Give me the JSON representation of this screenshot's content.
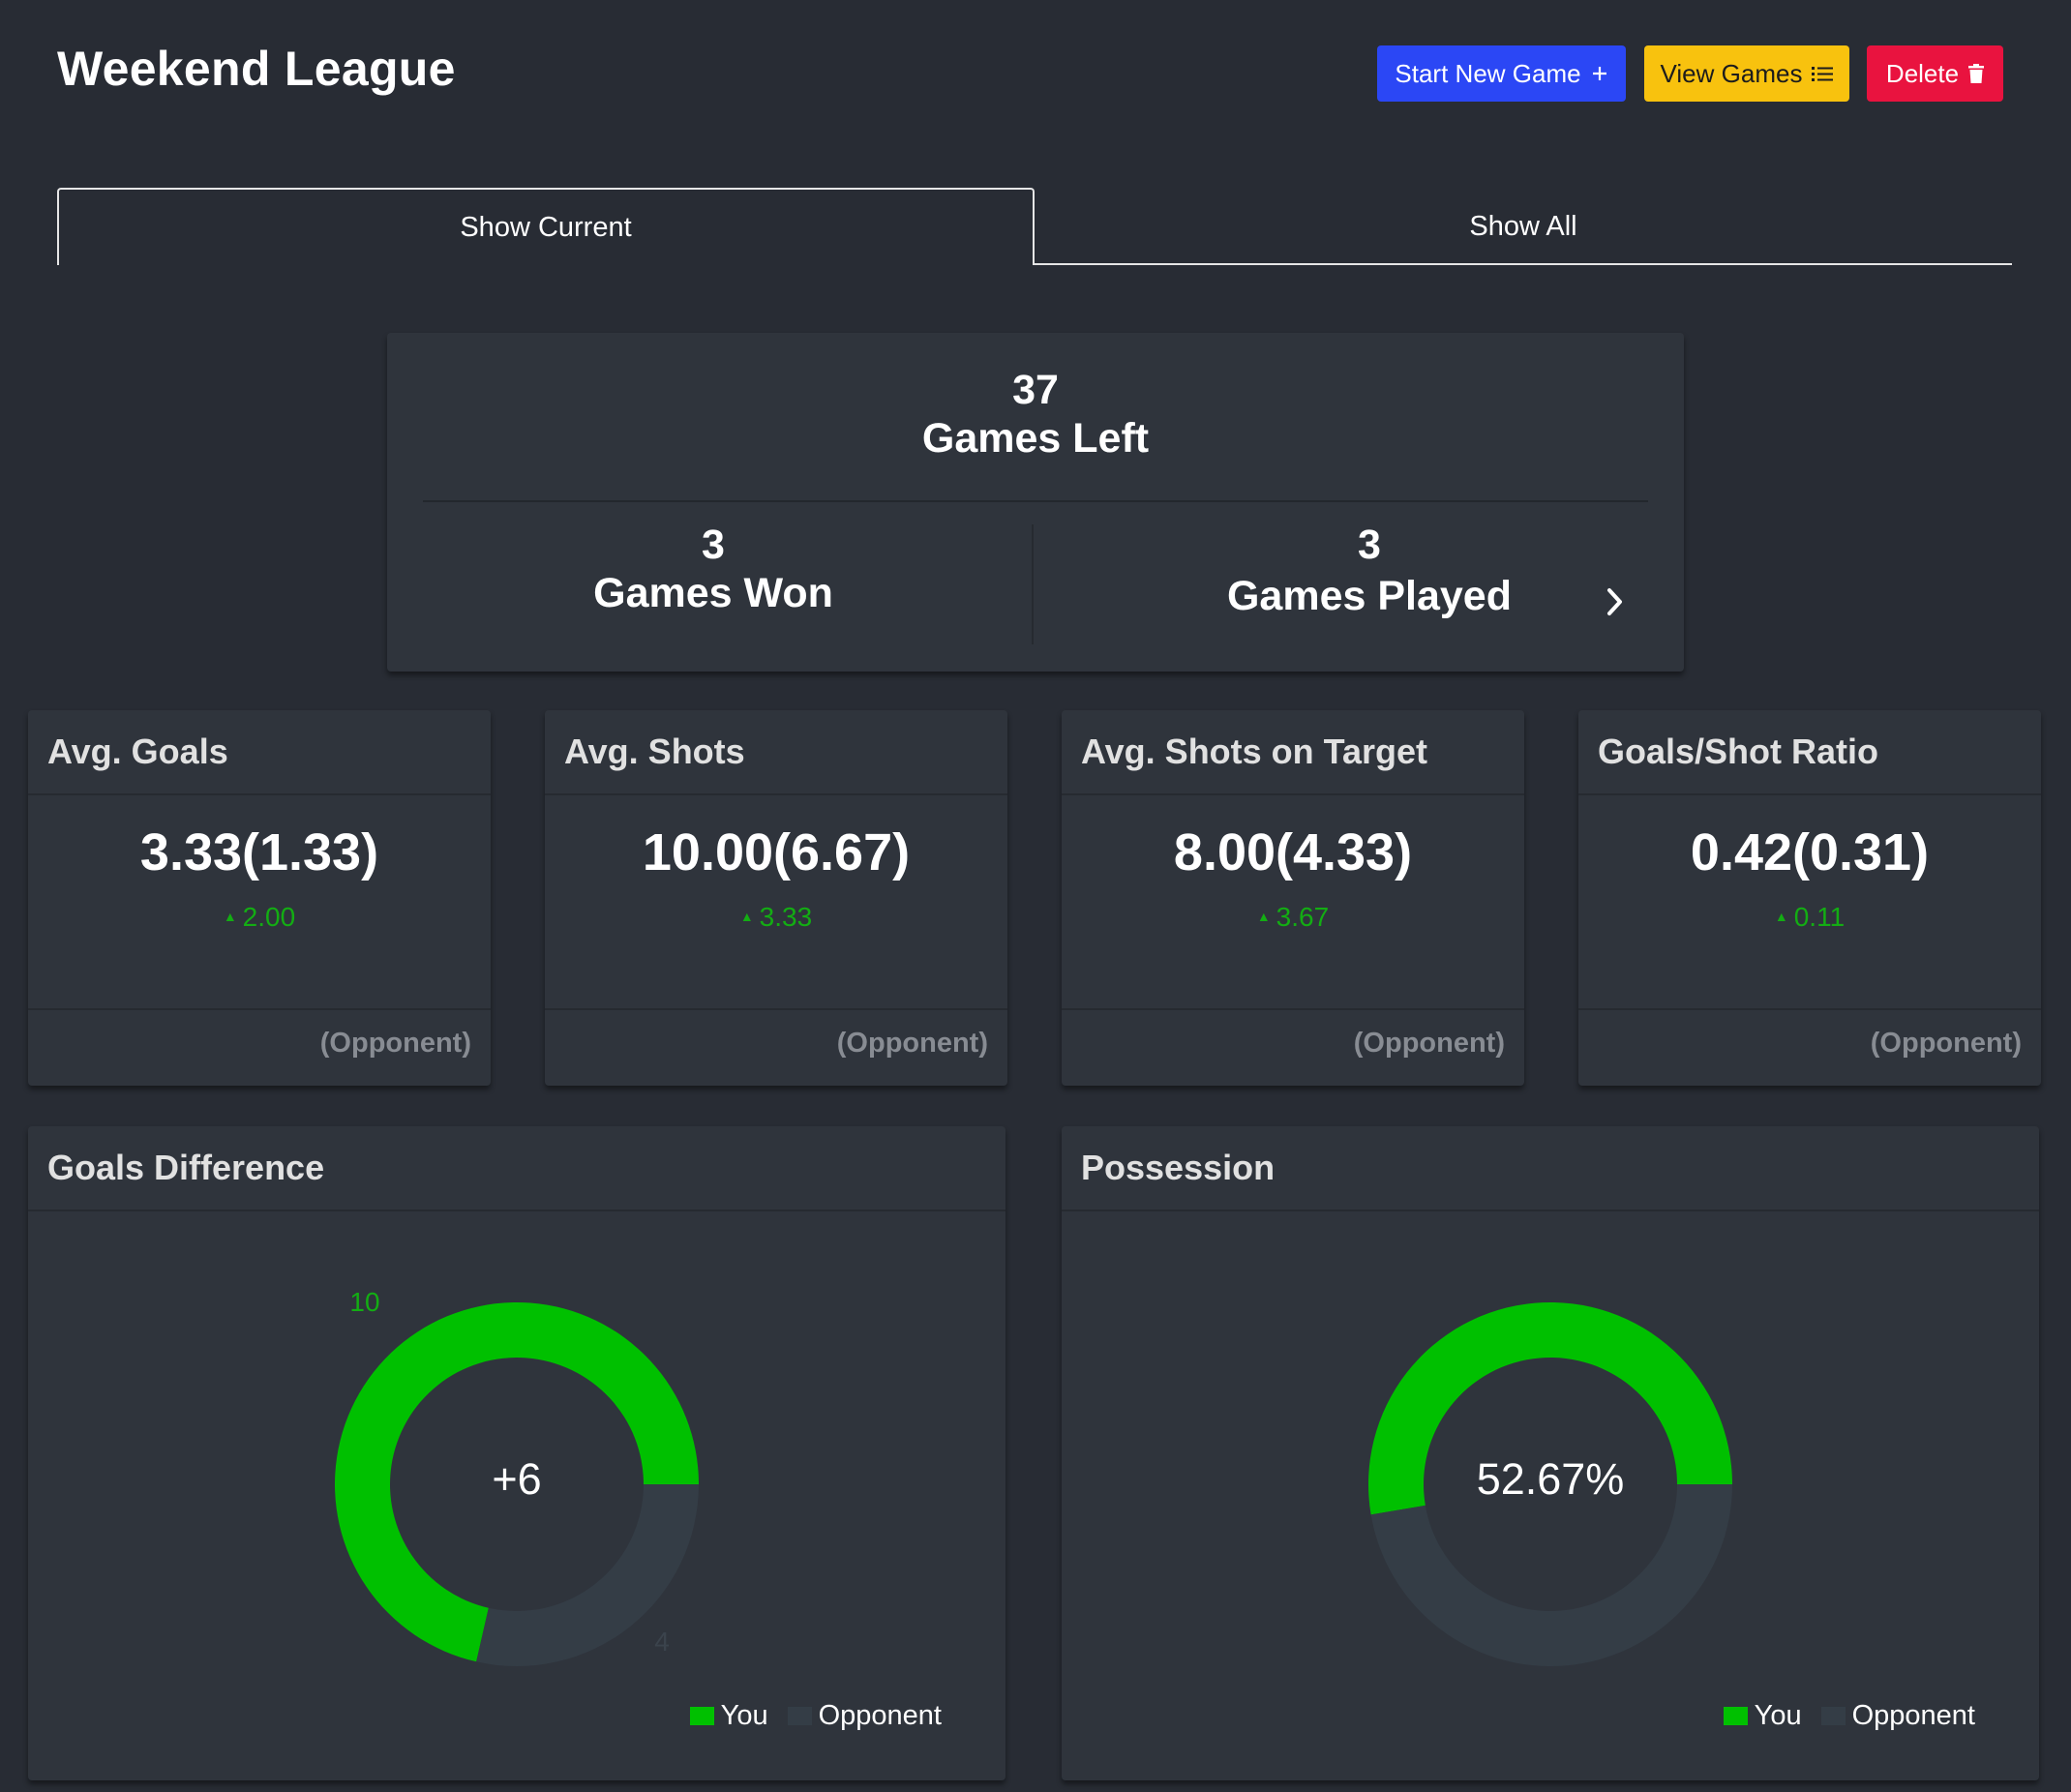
{
  "header": {
    "title": "Weekend League",
    "buttons": {
      "new_game": "Start New Game",
      "view_games": "View Games",
      "delete": "Delete"
    }
  },
  "tabs": {
    "current": "Show Current",
    "all": "Show All"
  },
  "summary": {
    "games_left": {
      "value": "37",
      "label": "Games Left"
    },
    "games_won": {
      "value": "3",
      "label": "Games Won"
    },
    "games_played": {
      "value": "3",
      "label": "Games Played"
    }
  },
  "stats": [
    {
      "title": "Avg. Goals",
      "value": "3.33(1.33)",
      "delta": "2.00",
      "footer": "(Opponent)"
    },
    {
      "title": "Avg. Shots",
      "value": "10.00(6.67)",
      "delta": "3.33",
      "footer": "(Opponent)"
    },
    {
      "title": "Avg. Shots on Target",
      "value": "8.00(4.33)",
      "delta": "3.67",
      "footer": "(Opponent)"
    },
    {
      "title": "Goals/Shot Ratio",
      "value": "0.42(0.31)",
      "delta": "0.11",
      "footer": "(Opponent)"
    }
  ],
  "colors": {
    "background": "#282c34",
    "card": "#2f343c",
    "you": "#00c000",
    "opponent": "#343d46",
    "delta_up": "#13ad13",
    "btn_new": "#2b47f5",
    "btn_view": "#f8c20e",
    "btn_delete": "#e9133f"
  },
  "chart_data": [
    {
      "type": "pie",
      "title": "Goals Difference",
      "center_label": "+6",
      "series": [
        {
          "name": "You",
          "value": 10,
          "label": "10"
        },
        {
          "name": "Opponent",
          "value": 4,
          "label": "4"
        }
      ],
      "legend": "bottom-right"
    },
    {
      "type": "pie",
      "title": "Possession",
      "center_label": "52.67%",
      "series": [
        {
          "name": "You",
          "value": 52.67
        },
        {
          "name": "Opponent",
          "value": 47.33
        }
      ],
      "legend": "bottom-right"
    }
  ]
}
